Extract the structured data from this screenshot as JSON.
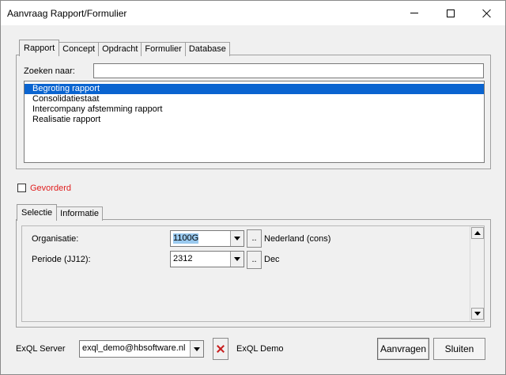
{
  "window": {
    "title": "Aanvraag Rapport/Formulier"
  },
  "top_tabs": [
    {
      "label": "Rapport",
      "active": true
    },
    {
      "label": "Concept",
      "active": false
    },
    {
      "label": "Opdracht",
      "active": false
    },
    {
      "label": "Formulier",
      "active": false
    },
    {
      "label": "Database",
      "active": false
    }
  ],
  "search": {
    "label": "Zoeken naar:",
    "value": ""
  },
  "report_list": [
    {
      "label": "Begroting rapport",
      "selected": true
    },
    {
      "label": "Consolidatiestaat",
      "selected": false
    },
    {
      "label": "Intercompany afstemming rapport",
      "selected": false
    },
    {
      "label": "Realisatie rapport",
      "selected": false
    }
  ],
  "advanced": {
    "label": "Gevorderd",
    "checked": false,
    "color": "#e02020"
  },
  "bottom_tabs": [
    {
      "label": "Selectie",
      "active": true
    },
    {
      "label": "Informatie",
      "active": false
    }
  ],
  "selection": {
    "organisatie": {
      "label": "Organisatie:",
      "value": "1100G",
      "browse_label": "..",
      "description": "Nederland (cons)"
    },
    "periode": {
      "label": "Periode (JJ12):",
      "value": "2312",
      "browse_label": "..",
      "description": "Dec"
    }
  },
  "footer": {
    "server_label": "ExQL Server",
    "server_value": "exql_demo@hbsoftware.nl",
    "server_description": "ExQL Demo",
    "request_button": "Aanvragen",
    "close_button": "Sluiten"
  },
  "colors": {
    "selection": "#0a64d0",
    "input_highlight": "#99c9ef"
  }
}
